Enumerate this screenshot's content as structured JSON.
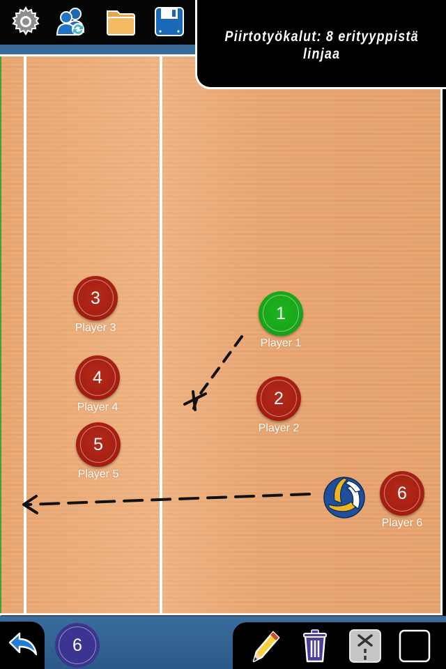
{
  "toolbar": {
    "icons": [
      {
        "name": "settings",
        "icon": "gear-icon"
      },
      {
        "name": "teams",
        "icon": "users-sync-icon"
      },
      {
        "name": "open",
        "icon": "folder-icon"
      },
      {
        "name": "save",
        "icon": "floppy-disk-icon"
      }
    ]
  },
  "info_panel": {
    "text_line1": "Piirtotyökalut: 8 erityyppistä",
    "text_line2": "linjaa"
  },
  "court": {
    "surface_color": "#e9a56f",
    "line_color": "#ffffff"
  },
  "players": [
    {
      "number": "1",
      "label": "Player 1",
      "color": "green"
    },
    {
      "number": "2",
      "label": "Player 2",
      "color": "red"
    },
    {
      "number": "3",
      "label": "Player 3",
      "color": "red"
    },
    {
      "number": "4",
      "label": "Player 4",
      "color": "red"
    },
    {
      "number": "5",
      "label": "Player 5",
      "color": "red"
    },
    {
      "number": "6",
      "label": "Player 6",
      "color": "red"
    }
  ],
  "ball": {
    "icon": "volleyball-icon"
  },
  "bottom_bar": {
    "undo_icon": "undo-arrow-icon",
    "player_count": "6",
    "tools": [
      {
        "name": "pencil",
        "icon": "pencil-icon"
      },
      {
        "name": "trash",
        "icon": "trash-icon"
      },
      {
        "name": "line-style",
        "icon": "block-line-icon"
      },
      {
        "name": "clear-box",
        "icon": "square-icon"
      }
    ]
  },
  "colors": {
    "accent_blue": "#386b9a",
    "player_red": "#a61f12",
    "player_green": "#19a519",
    "badge_purple": "#3b3591"
  }
}
